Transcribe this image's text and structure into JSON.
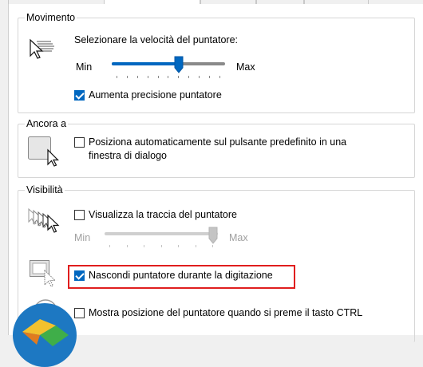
{
  "sections": {
    "movimento": {
      "title": "Movimento",
      "speed_label": "Selezionare la velocità del puntatore:",
      "min_label": "Min",
      "max_label": "Max",
      "speed_value": 0.6,
      "precision_label": "Aumenta precisione puntatore",
      "precision_checked": true
    },
    "ancora": {
      "title": "Ancora a",
      "snap_label_line1": "Posiziona automaticamente sul pulsante predefinito in una",
      "snap_label_line2": "finestra di dialogo",
      "snap_checked": false
    },
    "visibilita": {
      "title": "Visibilità",
      "trail_label": "Visualizza la traccia del puntatore",
      "trail_checked": false,
      "trail_min_label": "Min",
      "trail_max_label": "Max",
      "trail_value": 1.0,
      "hide_label": "Nascondi puntatore durante la digitazione",
      "hide_checked": true,
      "ctrl_label": "Mostra posizione del puntatore quando si preme il tasto CTRL",
      "ctrl_checked": false
    }
  },
  "colors": {
    "accent": "#0067c0",
    "highlight": "#e01e1e",
    "disabled": "#a0a0a0"
  }
}
